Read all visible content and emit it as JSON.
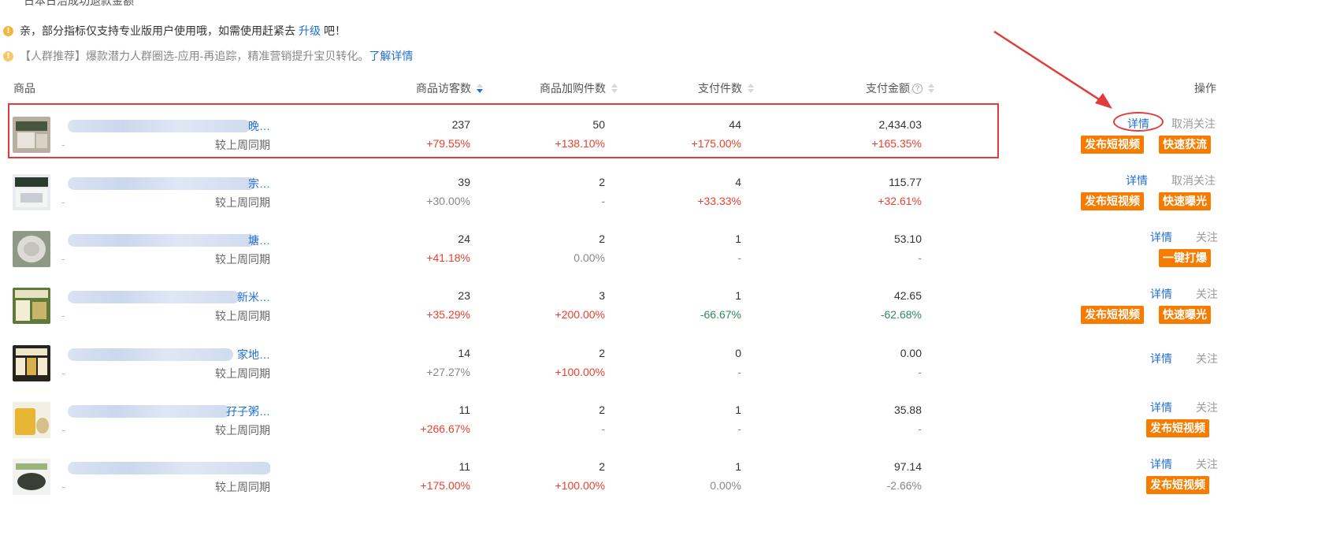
{
  "top_cut_text": "日本日治成功退款金额",
  "notices": [
    {
      "icon": "warning-icon",
      "text": "亲，部分指标仅支持专业版用户使用哦，如需使用赶紧去",
      "link": "升级",
      "suffix": "吧！"
    },
    {
      "icon": "warning-icon",
      "text": "【人群推荐】爆款潜力人群圈选-应用-再追踪，精准营销提升宝贝转化。",
      "link": "了解详情"
    }
  ],
  "table": {
    "headers": {
      "product": "商品",
      "visitors": "商品访客数",
      "cart": "商品加购件数",
      "paid_qty": "支付件数",
      "paid_amount": "支付金额",
      "ops": "操作"
    },
    "compare_label": "较上周同期",
    "rows": [
      {
        "name_tail": "晚…",
        "visitors": "237",
        "visitors_chg": "+79.55%",
        "cart": "50",
        "cart_chg": "+138.10%",
        "qty": "44",
        "qty_chg": "+175.00%",
        "amount": "2,434.03",
        "amount_chg": "+165.35%",
        "detail": "详情",
        "follow": "取消关注",
        "buttons": [
          "发布短视频",
          "快速获流"
        ]
      },
      {
        "name_tail": "宗…",
        "visitors": "39",
        "visitors_chg": "+30.00%",
        "cart": "2",
        "cart_chg": "-",
        "qty": "4",
        "qty_chg": "+33.33%",
        "amount": "115.77",
        "amount_chg": "+32.61%",
        "detail": "详情",
        "follow": "取消关注",
        "buttons": [
          "发布短视频",
          "快速曝光"
        ]
      },
      {
        "name_tail": "塘…",
        "visitors": "24",
        "visitors_chg": "+41.18%",
        "cart": "2",
        "cart_chg": "0.00%",
        "qty": "1",
        "qty_chg": "-",
        "amount": "53.10",
        "amount_chg": "-",
        "detail": "详情",
        "follow": "关注",
        "buttons": [
          "一键打爆"
        ]
      },
      {
        "name_tail": "新米…",
        "visitors": "23",
        "visitors_chg": "+35.29%",
        "cart": "3",
        "cart_chg": "+200.00%",
        "qty": "1",
        "qty_chg": "-66.67%",
        "amount": "42.65",
        "amount_chg": "-62.68%",
        "detail": "详情",
        "follow": "关注",
        "buttons": [
          "发布短视频",
          "快速曝光"
        ]
      },
      {
        "name_tail": "家地…",
        "visitors": "14",
        "visitors_chg": "+27.27%",
        "cart": "2",
        "cart_chg": "+100.00%",
        "qty": "0",
        "qty_chg": "-",
        "amount": "0.00",
        "amount_chg": "-",
        "detail": "详情",
        "follow": "关注",
        "buttons": []
      },
      {
        "name_tail": "孖子粥…",
        "visitors": "11",
        "visitors_chg": "+266.67%",
        "cart": "2",
        "cart_chg": "-",
        "qty": "1",
        "qty_chg": "-",
        "amount": "35.88",
        "amount_chg": "-",
        "detail": "详情",
        "follow": "关注",
        "buttons": [
          "发布短视频"
        ]
      },
      {
        "name_tail": "",
        "visitors": "11",
        "visitors_chg": "+175.00%",
        "cart": "2",
        "cart_chg": "+100.00%",
        "qty": "1",
        "qty_chg": "0.00%",
        "amount": "97.14",
        "amount_chg": "-2.66%",
        "detail": "详情",
        "follow": "关注",
        "buttons": [
          "发布短视频"
        ]
      }
    ]
  },
  "colors": {
    "link": "#1f6fd8",
    "positive": "#e8412e",
    "negative": "#2e8b57",
    "button": "#f57c00",
    "highlight": "#e03c3c"
  }
}
